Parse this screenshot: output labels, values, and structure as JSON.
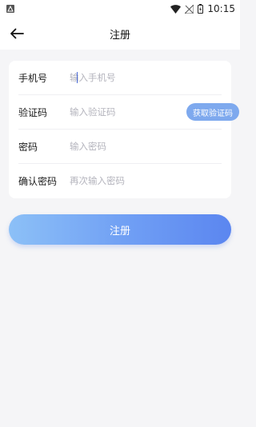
{
  "status_bar": {
    "time": "10:15",
    "icons": [
      "notification-icon",
      "wifi-icon",
      "no-signal-icon",
      "battery-icon"
    ]
  },
  "header": {
    "title": "注册",
    "back_icon": "arrow-left-icon"
  },
  "form": {
    "phone": {
      "label": "手机号",
      "placeholder": "输入手机号",
      "value": ""
    },
    "code": {
      "label": "验证码",
      "placeholder": "输入验证码",
      "value": "",
      "button_label": "获取验证码"
    },
    "password": {
      "label": "密码",
      "placeholder": "输入密码",
      "value": ""
    },
    "confirm_password": {
      "label": "确认密码",
      "placeholder": "再次输入密码",
      "value": ""
    }
  },
  "submit": {
    "label": "注册"
  },
  "colors": {
    "accent": "#6f9ef4",
    "code_button": "#7ea9ee",
    "background": "#f5f5f7",
    "caret": "#4b6bd8"
  }
}
